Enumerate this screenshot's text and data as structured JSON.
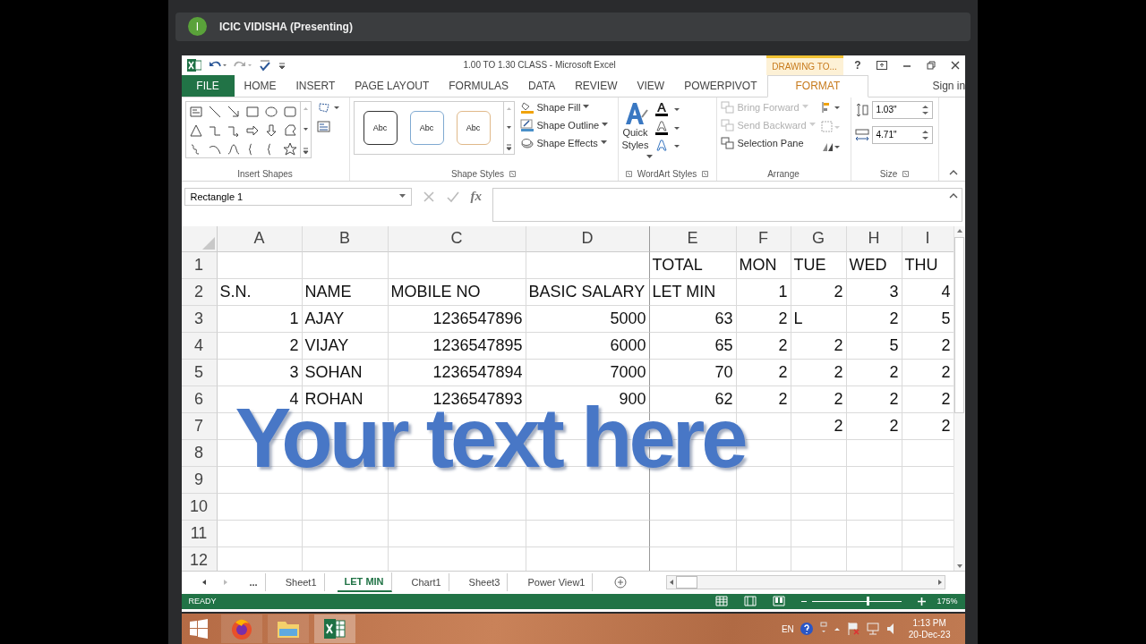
{
  "presenter_bar": {
    "avatar_letter": "I",
    "title": "ICIC VIDISHA (Presenting)"
  },
  "window": {
    "title": "1.00 TO 1.30 CLASS - Microsoft Excel",
    "context_tab_group": "DRAWING TO...",
    "help": "?",
    "sign_in": "Sign in"
  },
  "ribbon_tabs": [
    {
      "label": "FILE",
      "kind": "file",
      "selected": false
    },
    {
      "label": "HOME",
      "kind": "tab",
      "selected": false
    },
    {
      "label": "INSERT",
      "kind": "tab",
      "selected": false
    },
    {
      "label": "PAGE LAYOUT",
      "kind": "tab",
      "selected": false
    },
    {
      "label": "FORMULAS",
      "kind": "tab",
      "selected": false
    },
    {
      "label": "DATA",
      "kind": "tab",
      "selected": false
    },
    {
      "label": "REVIEW",
      "kind": "tab",
      "selected": false
    },
    {
      "label": "VIEW",
      "kind": "tab",
      "selected": false
    },
    {
      "label": "POWERPIVOT",
      "kind": "tab",
      "selected": false
    },
    {
      "label": "FORMAT",
      "kind": "tab",
      "selected": true
    }
  ],
  "ribbon": {
    "insert_shapes": {
      "label": "Insert Shapes"
    },
    "shape_styles": {
      "label": "Shape Styles",
      "presets": [
        "Abc",
        "Abc",
        "Abc"
      ],
      "commands": [
        "Shape Fill",
        "Shape Outline",
        "Shape Effects"
      ]
    },
    "wordart_styles": {
      "label": "WordArt Styles",
      "quick_styles": [
        "Quick",
        "Styles"
      ]
    },
    "arrange": {
      "label": "Arrange",
      "commands": [
        {
          "label": "Bring Forward",
          "disabled": true
        },
        {
          "label": "Send Backward",
          "disabled": true
        },
        {
          "label": "Selection Pane",
          "disabled": false
        }
      ]
    },
    "size": {
      "label": "Size",
      "height": "1.03\"",
      "width": "4.71\""
    }
  },
  "formula_bar": {
    "name_box": "Rectangle 1",
    "fx": "fx"
  },
  "sheet": {
    "columns": [
      "A",
      "B",
      "C",
      "D",
      "E",
      "F",
      "G",
      "H",
      "I"
    ],
    "rows": [
      {
        "number": "1",
        "cells": [
          null,
          null,
          null,
          null,
          {
            "text": "TOTAL",
            "kind": "text"
          },
          {
            "text": "MON",
            "kind": "text"
          },
          {
            "text": "TUE",
            "kind": "text"
          },
          {
            "text": "WED",
            "kind": "text"
          },
          {
            "text": "THU",
            "kind": "text"
          }
        ]
      },
      {
        "number": "2",
        "cells": [
          {
            "text": "S.N.",
            "kind": "text"
          },
          {
            "text": "NAME",
            "kind": "text"
          },
          {
            "text": "MOBILE NO",
            "kind": "text"
          },
          {
            "text": "BASIC SALARY",
            "kind": "text"
          },
          {
            "text": "LET MIN",
            "kind": "text"
          },
          {
            "text": "1",
            "kind": "number"
          },
          {
            "text": "2",
            "kind": "number"
          },
          {
            "text": "3",
            "kind": "number"
          },
          {
            "text": "4",
            "kind": "number"
          }
        ]
      },
      {
        "number": "3",
        "cells": [
          {
            "text": "1",
            "kind": "number"
          },
          {
            "text": "AJAY",
            "kind": "text"
          },
          {
            "text": "1236547896",
            "kind": "number"
          },
          {
            "text": "5000",
            "kind": "number"
          },
          {
            "text": "63",
            "kind": "number"
          },
          {
            "text": "2",
            "kind": "number"
          },
          {
            "text": "L",
            "kind": "text"
          },
          {
            "text": "2",
            "kind": "number"
          },
          {
            "text": "5",
            "kind": "number"
          }
        ]
      },
      {
        "number": "4",
        "cells": [
          {
            "text": "2",
            "kind": "number"
          },
          {
            "text": "VIJAY",
            "kind": "text"
          },
          {
            "text": "1236547895",
            "kind": "number"
          },
          {
            "text": "6000",
            "kind": "number"
          },
          {
            "text": "65",
            "kind": "number"
          },
          {
            "text": "2",
            "kind": "number"
          },
          {
            "text": "2",
            "kind": "number"
          },
          {
            "text": "5",
            "kind": "number"
          },
          {
            "text": "2",
            "kind": "number"
          }
        ]
      },
      {
        "number": "5",
        "cells": [
          {
            "text": "3",
            "kind": "number"
          },
          {
            "text": "SOHAN",
            "kind": "text"
          },
          {
            "text": "1236547894",
            "kind": "number"
          },
          {
            "text": "7000",
            "kind": "number"
          },
          {
            "text": "70",
            "kind": "number"
          },
          {
            "text": "2",
            "kind": "number"
          },
          {
            "text": "2",
            "kind": "number"
          },
          {
            "text": "2",
            "kind": "number"
          },
          {
            "text": "2",
            "kind": "number"
          }
        ]
      },
      {
        "number": "6",
        "cells": [
          {
            "text": "4",
            "kind": "number"
          },
          {
            "text": "ROHAN",
            "kind": "text"
          },
          {
            "text": "1236547893",
            "kind": "number"
          },
          {
            "text": "900",
            "kind": "number"
          },
          {
            "text": "62",
            "kind": "number"
          },
          {
            "text": "2",
            "kind": "number"
          },
          {
            "text": "2",
            "kind": "number"
          },
          {
            "text": "2",
            "kind": "number"
          },
          {
            "text": "2",
            "kind": "number"
          }
        ]
      },
      {
        "number": "7",
        "cells": [
          null,
          null,
          null,
          null,
          null,
          null,
          {
            "text": "2",
            "kind": "number"
          },
          {
            "text": "2",
            "kind": "number"
          },
          {
            "text": "2",
            "kind": "number"
          }
        ]
      },
      {
        "number": "8",
        "cells": []
      },
      {
        "number": "9",
        "cells": []
      },
      {
        "number": "10",
        "cells": []
      },
      {
        "number": "11",
        "cells": []
      },
      {
        "number": "12",
        "cells": []
      }
    ],
    "wordart": "Your text here"
  },
  "sheet_tabs": [
    {
      "label": "...",
      "kind": "more"
    },
    {
      "label": "Sheet1",
      "kind": "sheet",
      "selected": false
    },
    {
      "label": "LET MIN",
      "kind": "sheet",
      "selected": true
    },
    {
      "label": "Chart1",
      "kind": "sheet",
      "selected": false
    },
    {
      "label": "Sheet3",
      "kind": "sheet",
      "selected": false
    },
    {
      "label": "Power View1",
      "kind": "sheet",
      "selected": false
    }
  ],
  "status_bar": {
    "status": "READY",
    "zoom": {
      "level": 0.62,
      "reading": "175%"
    }
  },
  "taskbar": {
    "language": "EN",
    "time": "1:13 PM",
    "date": "20-Dec-23"
  }
}
